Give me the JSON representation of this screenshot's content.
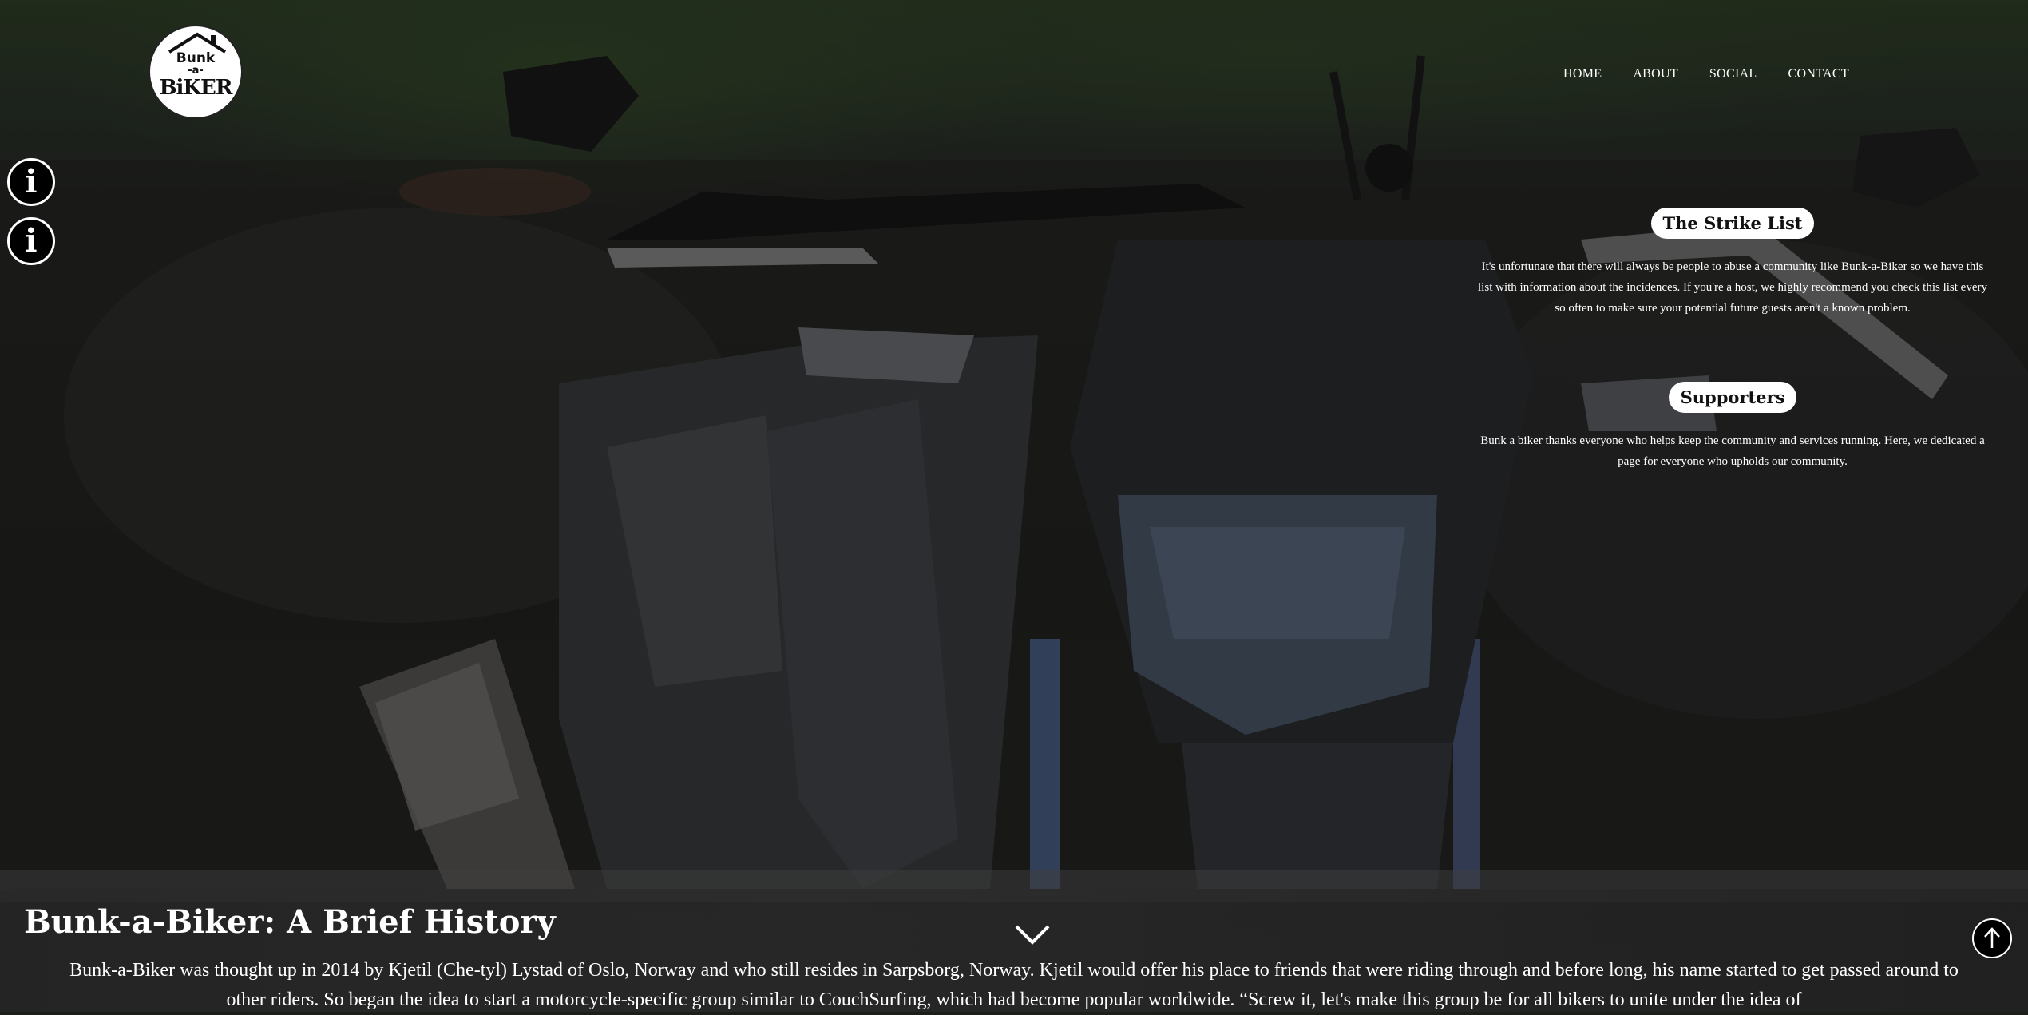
{
  "brand": {
    "logo_line1": "Bunk",
    "logo_line2": "-a-",
    "logo_line3": "BiKER"
  },
  "nav": {
    "items": [
      "HOME",
      "ABOUT",
      "SOCIAL",
      "CONTACT"
    ]
  },
  "side_buttons": [
    {
      "icon": "info-icon",
      "glyph": "i"
    },
    {
      "icon": "info-icon",
      "glyph": "i"
    }
  ],
  "sections": {
    "strike_list": {
      "title": "The Strike List",
      "text": "It's unfortunate that there will always be people to abuse a community like Bunk-a-Biker so we have this list with information about the incidences. If you're a host, we highly recommend you check this list every so often to make sure your potential future guests aren't a known problem."
    },
    "supporters": {
      "title": "Supporters",
      "text": "Bunk a biker thanks everyone who helps keep the community and services running. Here, we dedicated a page for everyone who upholds our community."
    }
  },
  "history": {
    "title": "Bunk-a-Biker: A Brief History",
    "text": "Bunk-a-Biker was thought up in 2014 by Kjetil (Che-tyl) Lystad of Oslo, Norway and who still resides in Sarpsborg, Norway. Kjetil would offer his place to friends that were riding through and before long, his name started to get passed around to other riders. So began the idea to start a motorcycle-specific group similar to CouchSurfing, which had become popular worldwide. “Screw it, let's make this group be for all bikers to unite under the idea of"
  },
  "icons": {
    "scroll_down": "chevron-down-icon",
    "back_to_top": "arrow-up-icon"
  }
}
